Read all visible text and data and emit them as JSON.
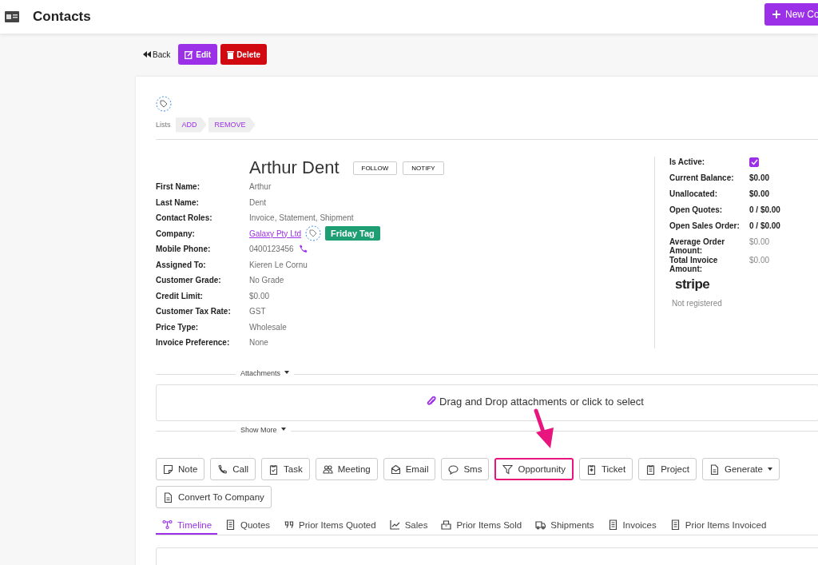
{
  "header": {
    "title": "Contacts",
    "new_button": "New Co"
  },
  "toolbar": {
    "back": "Back",
    "edit": "Edit",
    "delete": "Delete"
  },
  "lists": {
    "label": "Lists",
    "actions": [
      "ADD",
      "REMOVE"
    ]
  },
  "contact": {
    "name": "Arthur Dent",
    "buttons": [
      "FOLLOW",
      "NOTIFY"
    ],
    "fields": [
      {
        "label": "First Name:",
        "value": "Arthur",
        "kind": "text"
      },
      {
        "label": "Last Name:",
        "value": "Dent",
        "kind": "text"
      },
      {
        "label": "Contact Roles:",
        "value": "Invoice, Statement, Shipment",
        "kind": "text"
      },
      {
        "label": "Company:",
        "value": "Galaxy Pty Ltd",
        "kind": "company",
        "tag": "Friday Tag",
        "color": "#1e9e73"
      },
      {
        "label": "Mobile Phone:",
        "value": "0400123456",
        "kind": "phone"
      },
      {
        "label": "Assigned To:",
        "value": "Kieren Le Cornu",
        "kind": "text"
      },
      {
        "label": "Customer Grade:",
        "value": "No Grade",
        "kind": "text"
      },
      {
        "label": "Credit Limit:",
        "value": "$0.00",
        "kind": "text"
      },
      {
        "label": "Customer Tax Rate:",
        "value": "GST",
        "kind": "text"
      },
      {
        "label": "Price Type:",
        "value": "Wholesale",
        "kind": "text"
      },
      {
        "label": "Invoice Preference:",
        "value": "None",
        "kind": "text"
      }
    ]
  },
  "summary": {
    "active": {
      "label": "Is Active:",
      "checked": true
    },
    "rows": [
      {
        "label": "Current Balance:",
        "value": "$0.00",
        "bold": true
      },
      {
        "label": "Unallocated:",
        "value": "$0.00",
        "bold": true
      },
      {
        "label": "Open Quotes:",
        "value": "0 / $0.00",
        "bold": true
      },
      {
        "label": "Open Sales Order:",
        "value": "0 / $0.00",
        "bold": true
      },
      {
        "label": "Average Order Amount:",
        "value": "$0.00",
        "bold": false
      },
      {
        "label": "Total Invoice Amount:",
        "value": "$0.00",
        "bold": false
      }
    ],
    "stripe": {
      "logo": "stripe",
      "status": "Not registered"
    }
  },
  "attachments": {
    "label": "Attachments",
    "dropzone": "Drag and Drop attachments or click to select",
    "show_more": "Show More"
  },
  "actions": [
    {
      "label": "Note",
      "highlighted": false,
      "dropdown": false
    },
    {
      "label": "Call",
      "highlighted": false,
      "dropdown": false
    },
    {
      "label": "Task",
      "highlighted": false,
      "dropdown": false
    },
    {
      "label": "Meeting",
      "highlighted": false,
      "dropdown": false
    },
    {
      "label": "Email",
      "highlighted": false,
      "dropdown": false
    },
    {
      "label": "Sms",
      "highlighted": false,
      "dropdown": false
    },
    {
      "label": "Opportunity",
      "highlighted": true,
      "dropdown": false
    },
    {
      "label": "Ticket",
      "highlighted": false,
      "dropdown": false
    },
    {
      "label": "Project",
      "highlighted": false,
      "dropdown": false
    },
    {
      "label": "Generate",
      "highlighted": false,
      "dropdown": true
    },
    {
      "label": "Convert To Company",
      "highlighted": false,
      "dropdown": false
    }
  ],
  "tabs": [
    {
      "label": "Timeline",
      "selected": true
    },
    {
      "label": "Quotes",
      "selected": false
    },
    {
      "label": "Prior Items Quoted",
      "selected": false
    },
    {
      "label": "Sales",
      "selected": false
    },
    {
      "label": "Prior Items Sold",
      "selected": false
    },
    {
      "label": "Shipments",
      "selected": false
    },
    {
      "label": "Invoices",
      "selected": false
    },
    {
      "label": "Prior Items Invoiced",
      "selected": false
    }
  ]
}
